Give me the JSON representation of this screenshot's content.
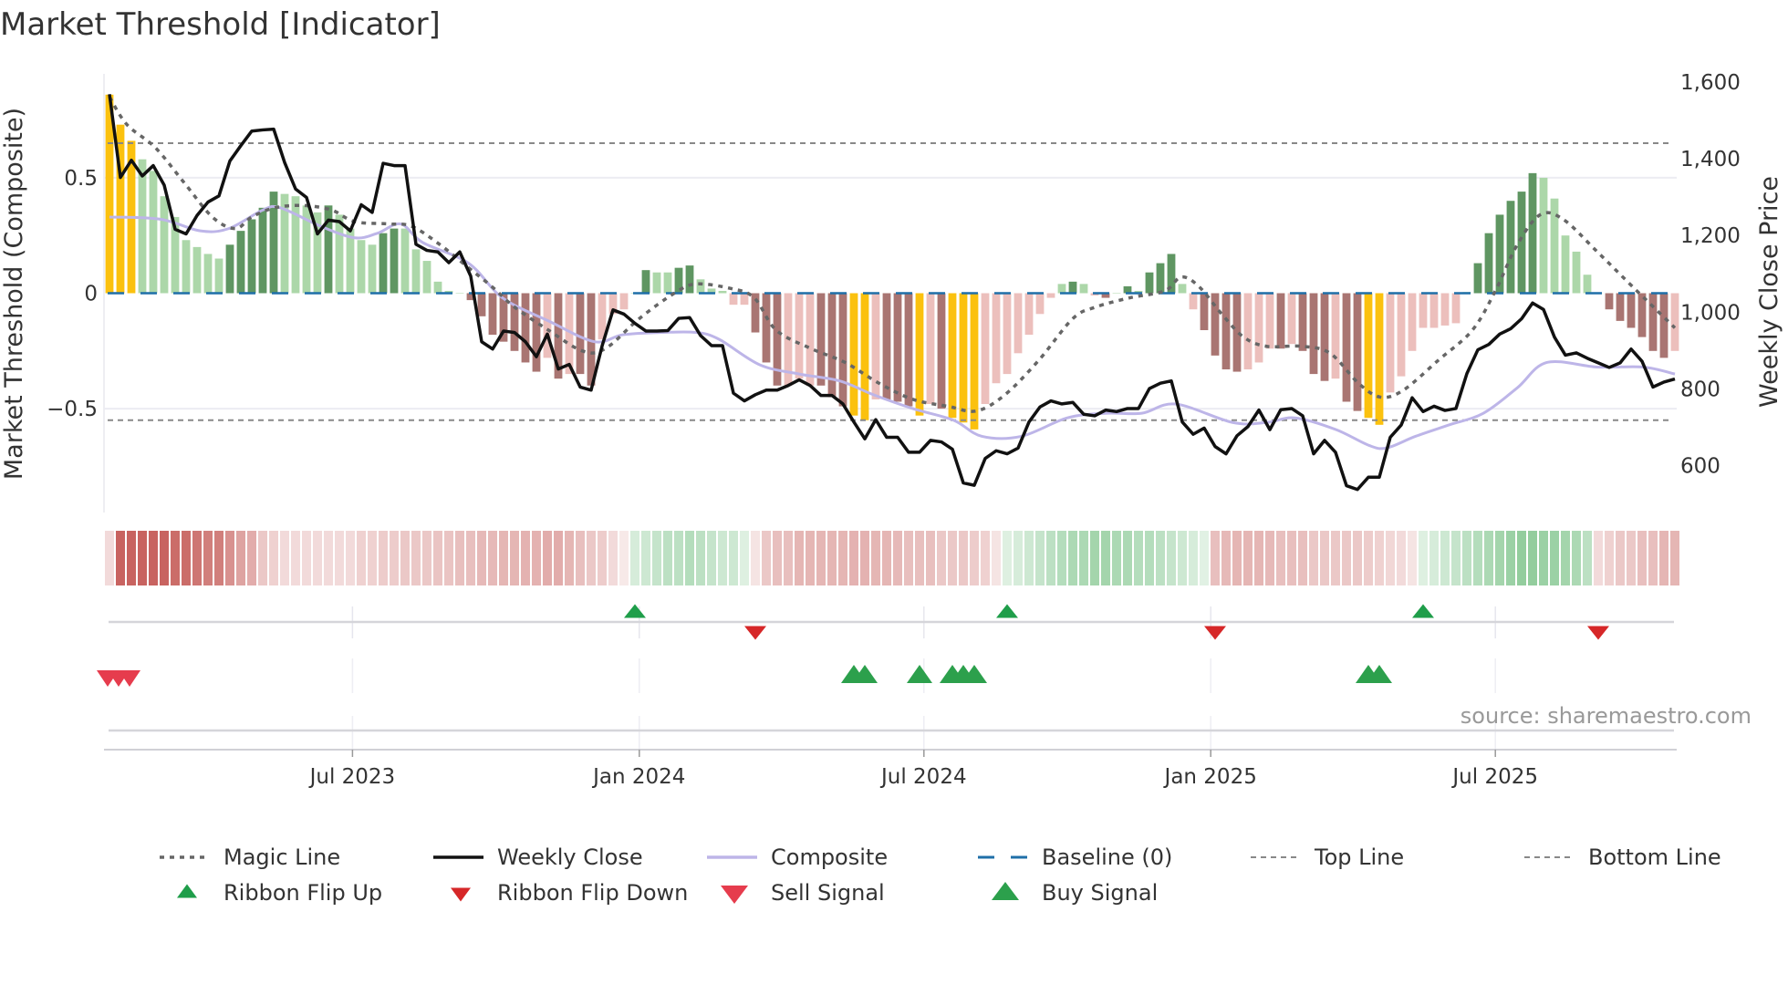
{
  "chart_data": {
    "type": "bar",
    "title": "Market Threshold [Indicator]",
    "y_left": {
      "label": "Market Threshold (Composite)",
      "range": [
        -0.95,
        0.95
      ],
      "ticks": [
        {
          "value": 0.5,
          "label": "0.5"
        },
        {
          "value": 0,
          "label": "0"
        },
        {
          "value": -0.5,
          "label": "−0.5"
        }
      ]
    },
    "y_right": {
      "label": "Weekly Close Price",
      "range": [
        478,
        1621
      ],
      "ticks": [
        {
          "value": 1600,
          "label": "1,600"
        },
        {
          "value": 1400,
          "label": "1,400"
        },
        {
          "value": 1200,
          "label": "1,200"
        },
        {
          "value": 1000,
          "label": "1,000"
        },
        {
          "value": 800,
          "label": "800"
        },
        {
          "value": 600,
          "label": "600"
        }
      ]
    },
    "x_ticks": [
      {
        "label": "Jul 2023",
        "index": 22.2
      },
      {
        "label": "Jan 2024",
        "index": 48.4
      },
      {
        "label": "Jul 2024",
        "index": 74.4
      },
      {
        "label": "Jan 2025",
        "index": 100.6
      },
      {
        "label": "Jul 2025",
        "index": 126.6
      }
    ],
    "reference_lines": {
      "top_line": 0.65,
      "bottom_line": -0.55,
      "baseline": 0
    },
    "grid": true,
    "bar_palette": {
      "Y": "#fbc10e",
      "G": "#5f9662",
      "g": "#acd7a9",
      "R": "#a97572",
      "r": "#ecbfbc"
    },
    "bar_states": [
      "YYYggggggggGGGGGggggGggggGGggggggRRRR",
      "RRRrRrRRrrrgGggGGgggrrRRRrrrRRRYYrRRR",
      "YrRYYYrrrrrrrgGgrRgGgGGGgrRRRRrrrRrRR",
      "RrRRYYrrrrrrrgGGGGGGggggggRRRRRRr"
    ],
    "composite_bars": [
      0.86,
      0.73,
      0.66,
      0.58,
      0.53,
      0.42,
      0.33,
      0.23,
      0.2,
      0.17,
      0.15,
      0.21,
      0.27,
      0.32,
      0.37,
      0.44,
      0.43,
      0.42,
      0.38,
      0.35,
      0.38,
      0.34,
      0.28,
      0.23,
      0.21,
      0.26,
      0.28,
      0.28,
      0.19,
      0.14,
      0.05,
      0.01,
      0,
      -0.03,
      -0.1,
      -0.18,
      -0.21,
      -0.25,
      -0.3,
      -0.34,
      -0.28,
      -0.37,
      -0.35,
      -0.35,
      -0.4,
      -0.2,
      -0.09,
      -0.07,
      0,
      0.1,
      0.09,
      0.09,
      0.11,
      0.12,
      0.06,
      0.02,
      0.01,
      -0.05,
      -0.05,
      -0.17,
      -0.3,
      -0.4,
      -0.4,
      -0.37,
      -0.4,
      -0.4,
      -0.45,
      -0.49,
      -0.53,
      -0.55,
      -0.46,
      -0.46,
      -0.47,
      -0.49,
      -0.53,
      -0.48,
      -0.5,
      -0.54,
      -0.56,
      -0.59,
      -0.48,
      -0.39,
      -0.35,
      -0.26,
      -0.18,
      -0.09,
      -0.02,
      0.04,
      0.05,
      0.04,
      -0.01,
      -0.02,
      0,
      0.03,
      0.01,
      0.09,
      0.13,
      0.17,
      0.04,
      -0.07,
      -0.16,
      -0.27,
      -0.33,
      -0.34,
      -0.33,
      -0.3,
      -0.24,
      -0.24,
      -0.22,
      -0.25,
      -0.35,
      -0.38,
      -0.37,
      -0.47,
      -0.51,
      -0.54,
      -0.57,
      -0.43,
      -0.36,
      -0.25,
      -0.15,
      -0.15,
      -0.14,
      -0.13,
      0.005,
      0.13,
      0.26,
      0.34,
      0.4,
      0.44,
      0.52,
      0.5,
      0.41,
      0.25,
      0.18,
      0.08,
      0,
      -0.07,
      -0.12,
      -0.15,
      -0.19,
      -0.25,
      -0.28,
      -0.25
    ],
    "weekly_close": [
      1568,
      1351,
      1396,
      1355,
      1382,
      1331,
      1216,
      1204,
      1252,
      1287,
      1303,
      1394,
      1434,
      1472,
      1475,
      1477,
      1390,
      1321,
      1299,
      1204,
      1240,
      1236,
      1212,
      1280,
      1260,
      1388,
      1382,
      1382,
      1177,
      1161,
      1157,
      1129,
      1157,
      1094,
      923,
      904,
      951,
      947,
      923,
      884,
      943,
      852,
      864,
      805,
      797,
      912,
      1006,
      995,
      971,
      951,
      951,
      952,
      984,
      986,
      939,
      913,
      913,
      789,
      769,
      785,
      797,
      797,
      809,
      824,
      809,
      783,
      783,
      761,
      714,
      670,
      720,
      674,
      674,
      635,
      635,
      666,
      662,
      643,
      555,
      549,
      619,
      639,
      631,
      646,
      714,
      753,
      769,
      761,
      765,
      734,
      730,
      745,
      741,
      749,
      749,
      801,
      815,
      821,
      714,
      682,
      698,
      650,
      631,
      678,
      702,
      745,
      694,
      746,
      749,
      730,
      631,
      666,
      635,
      548,
      538,
      570,
      570,
      674,
      706,
      777,
      741,
      755,
      744,
      749,
      840,
      902,
      916,
      943,
      957,
      983,
      1024,
      1007,
      935,
      888,
      894,
      880,
      868,
      856,
      868,
      904,
      872,
      805,
      818,
      826
    ],
    "composite_line": {
      "index": [
        0,
        4.7,
        8.3,
        10.9,
        14,
        15.6,
        19.3,
        22.4,
        24.5,
        26.6,
        28.6,
        32.8,
        35.9,
        40.1,
        44.3,
        46.9,
        50.5,
        53.6,
        55.7,
        59.4,
        63,
        66.7,
        69.8,
        73.4,
        77.1,
        79.7,
        83.3,
        87.5,
        91.1,
        94.3,
        97.4,
        102.6,
        105.7,
        108.3,
        112,
        115.1,
        116.7,
        119.3,
        122.4,
        125.5,
        128.6,
        131.3,
        135.9,
        140.1,
        143
      ],
      "values": [
        0.33,
        0.32,
        0.27,
        0.28,
        0.36,
        0.37,
        0.29,
        0.24,
        0.26,
        0.3,
        0.22,
        0.13,
        -0.02,
        -0.12,
        -0.21,
        -0.18,
        -0.17,
        -0.17,
        -0.2,
        -0.31,
        -0.35,
        -0.38,
        -0.44,
        -0.5,
        -0.55,
        -0.62,
        -0.62,
        -0.54,
        -0.52,
        -0.52,
        -0.48,
        -0.56,
        -0.56,
        -0.54,
        -0.59,
        -0.66,
        -0.67,
        -0.62,
        -0.57,
        -0.52,
        -0.41,
        -0.3,
        -0.32,
        -0.32,
        -0.35
      ]
    },
    "magic_line": {
      "index": [
        0,
        1.6,
        4.2,
        6.8,
        9.4,
        11.5,
        13,
        15.1,
        17.7,
        20.3,
        22.4,
        25.5,
        27.6,
        30.2,
        32.8,
        34.9,
        37,
        40.1,
        43.2,
        45.3,
        48.4,
        51.6,
        53.6,
        56.8,
        58.9,
        60.9,
        64.1,
        67.2,
        70.3,
        73.4,
        76.6,
        79.2,
        81.8,
        84.9,
        88,
        90.1,
        93.2,
        96.4,
        97.9,
        99.5,
        101.6,
        103.6,
        105.7,
        108.9,
        111.5,
        114.1,
        116.1,
        118.2,
        121.4,
        124.5,
        126.6,
        128.6,
        130.7,
        132.8,
        135.9,
        139.1,
        143
      ],
      "values": [
        0.85,
        0.73,
        0.63,
        0.48,
        0.33,
        0.28,
        0.33,
        0.37,
        0.38,
        0.36,
        0.31,
        0.3,
        0.29,
        0.21,
        0.11,
        0.03,
        -0.06,
        -0.16,
        -0.25,
        -0.24,
        -0.11,
        0,
        0.04,
        0.02,
        -0.02,
        -0.16,
        -0.24,
        -0.3,
        -0.39,
        -0.46,
        -0.49,
        -0.51,
        -0.44,
        -0.29,
        -0.11,
        -0.06,
        -0.02,
        0.01,
        0.07,
        0.03,
        -0.09,
        -0.19,
        -0.23,
        -0.23,
        -0.26,
        -0.39,
        -0.45,
        -0.42,
        -0.29,
        -0.16,
        0.01,
        0.21,
        0.34,
        0.32,
        0.18,
        0.03,
        -0.15
      ]
    },
    "ribbon": [
      -0.2,
      -0.85,
      -0.85,
      -0.85,
      -0.85,
      -0.85,
      -0.8,
      -0.8,
      -0.75,
      -0.7,
      -0.7,
      -0.6,
      -0.5,
      -0.45,
      -0.3,
      -0.25,
      -0.2,
      -0.2,
      -0.2,
      -0.2,
      -0.2,
      -0.2,
      -0.2,
      -0.25,
      -0.25,
      -0.28,
      -0.28,
      -0.3,
      -0.3,
      -0.3,
      -0.32,
      -0.32,
      -0.35,
      -0.35,
      -0.38,
      -0.38,
      -0.4,
      -0.4,
      -0.42,
      -0.42,
      -0.45,
      -0.45,
      -0.4,
      -0.35,
      -0.3,
      -0.28,
      -0.2,
      -0.12,
      0.25,
      0.3,
      0.35,
      0.4,
      0.4,
      0.45,
      0.4,
      0.35,
      0.3,
      0.3,
      0.2,
      -0.15,
      -0.3,
      -0.35,
      -0.35,
      -0.4,
      -0.4,
      -0.4,
      -0.4,
      -0.4,
      -0.42,
      -0.42,
      -0.4,
      -0.4,
      -0.38,
      -0.35,
      -0.35,
      -0.35,
      -0.3,
      -0.3,
      -0.3,
      -0.28,
      -0.25,
      -0.15,
      0.2,
      0.25,
      0.3,
      0.35,
      0.4,
      0.45,
      0.5,
      0.5,
      0.55,
      0.55,
      0.5,
      0.5,
      0.45,
      0.45,
      0.4,
      0.35,
      0.3,
      0.25,
      0.18,
      -0.35,
      -0.38,
      -0.4,
      -0.4,
      -0.4,
      -0.38,
      -0.35,
      -0.35,
      -0.35,
      -0.3,
      -0.3,
      -0.3,
      -0.3,
      -0.3,
      -0.28,
      -0.25,
      -0.22,
      -0.2,
      -0.15,
      0.2,
      0.25,
      0.3,
      0.35,
      0.4,
      0.45,
      0.5,
      0.55,
      0.6,
      0.65,
      0.65,
      0.6,
      0.6,
      0.55,
      0.5,
      0.4,
      -0.2,
      -0.25,
      -0.3,
      -0.3,
      -0.35,
      -0.35,
      -0.4,
      -0.4
    ],
    "signals": {
      "ribbon_flip_up": [
        48,
        82,
        120
      ],
      "ribbon_flip_down": [
        59,
        101,
        136
      ],
      "sell": [
        0,
        1,
        2
      ],
      "buy": [
        68,
        69,
        74,
        77,
        78,
        79,
        115,
        116
      ]
    },
    "legend": [
      {
        "label": "Magic Line",
        "kind": "dotted",
        "color": "#666666"
      },
      {
        "label": "Weekly Close",
        "kind": "solid",
        "color": "#111111"
      },
      {
        "label": "Composite",
        "kind": "solid",
        "color": "#bdb5e8"
      },
      {
        "label": "Baseline (0)",
        "kind": "dashed",
        "color": "#1f6fa8"
      },
      {
        "label": "Top Line",
        "kind": "thin-dashed",
        "color": "#888888"
      },
      {
        "label": "Bottom Line",
        "kind": "thin-dashed",
        "color": "#888888"
      },
      {
        "label": "Ribbon Flip Up",
        "kind": "tri-up-small",
        "color": "#1f9e4a"
      },
      {
        "label": "Ribbon Flip Down",
        "kind": "tri-down-small",
        "color": "#d62728"
      },
      {
        "label": "Sell Signal",
        "kind": "tri-down",
        "color": "#e63c4d"
      },
      {
        "label": "Buy Signal",
        "kind": "tri-up",
        "color": "#2ca04c"
      }
    ],
    "legend_position": "bottom",
    "source": "source: sharemaestro.com"
  }
}
